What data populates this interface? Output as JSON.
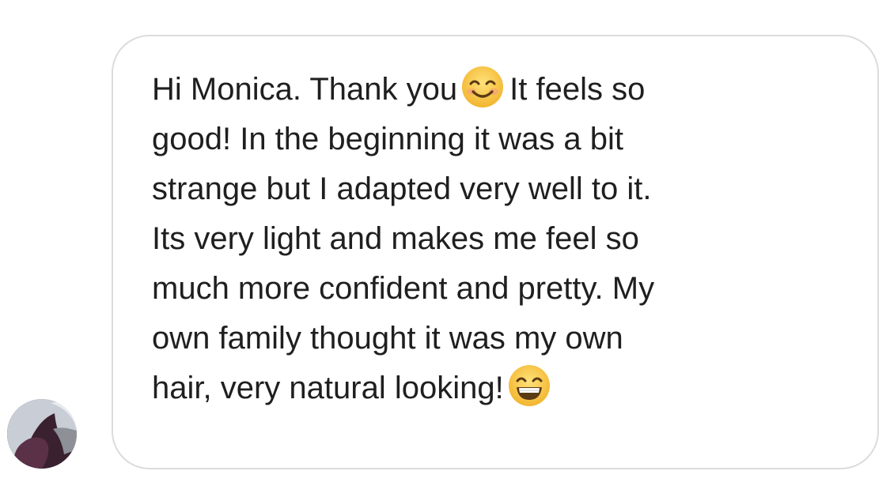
{
  "conversation": {
    "avatar_icon": "user-avatar-photo",
    "message": {
      "lines": [
        "Hi Monica. Thank you",
        "It feels so",
        "good! In the beginning it was a bit",
        "strange but I adapted very well to it.",
        "Its very light and makes me feel so",
        "much more confident and pretty. My",
        "own family thought it was my own",
        "hair, very natural looking!"
      ],
      "emoji_1": "smiling-face-with-smiling-eyes-icon",
      "emoji_2": "grinning-face-with-smiling-eyes-icon"
    }
  },
  "colors": {
    "bubble_border": "#dcdcdc",
    "text": "#1f1f1f",
    "emoji_yellow": "#f5c242"
  }
}
